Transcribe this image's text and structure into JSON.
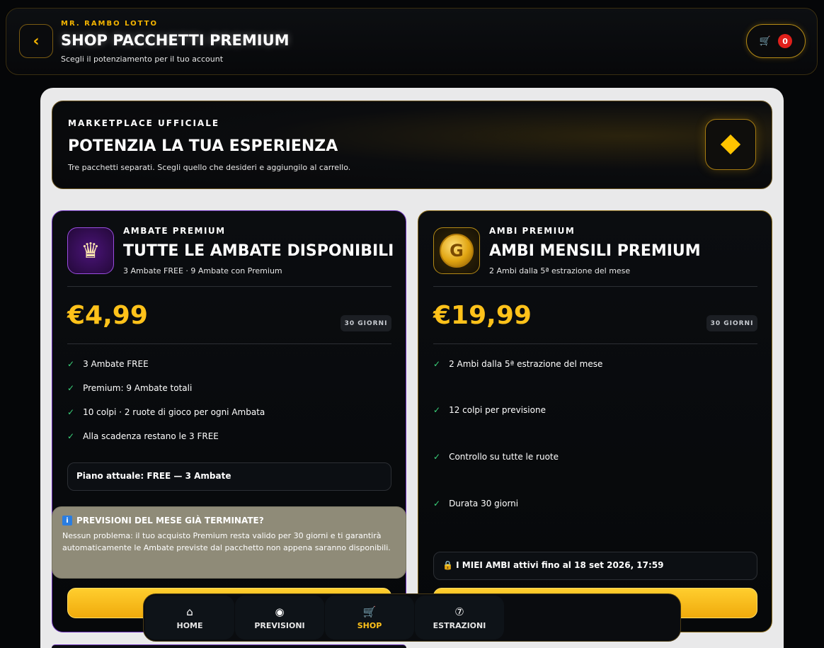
{
  "header": {
    "brand": "MR. RAMBO LOTTO",
    "title": "SHOP PACCHETTI PREMIUM",
    "subtitle": "Scegli il potenziamento per il tuo account",
    "back_icon": "chevron-left-icon",
    "cart_icon": "cart-icon",
    "cart_count": "0"
  },
  "hero": {
    "kicker": "MARKETPLACE UFFICIALE",
    "title": "POTENZIA LA TUA ESPERIENZA",
    "subtitle": "Tre pacchetti separati. Scegli quello che desideri e aggiungilo al carrello.",
    "badge_icon": "diamond-icon"
  },
  "cards": [
    {
      "kicker": "AMBATE PREMIUM",
      "title": "TUTTE LE AMBATE DISPONIBILI",
      "subtitle": "3 Ambate FREE · 9 Ambate con Premium",
      "icon": "crown-icon",
      "price": "€4,99",
      "duration": "30 GIORNI",
      "features": [
        "3 Ambate FREE",
        "Premium: 9 Ambate totali",
        "10 colpi · 2 ruote di gioco per ogni Ambata",
        "Alla scadenza restano le 3 FREE"
      ],
      "plan_status": "Piano attuale: FREE — 3 Ambate"
    },
    {
      "kicker": "AMBI PREMIUM",
      "title": "AMBI MENSILI PREMIUM",
      "subtitle": "2 Ambi dalla 5ª estrazione del mese",
      "icon": "coin-icon",
      "coin_letter": "G",
      "price": "€19,99",
      "duration": "30 GIORNI",
      "features": [
        "2 Ambi dalla 5ª estrazione del mese",
        "12 colpi per previsione",
        "Controllo su tutte le ruote",
        "Durata 30 giorni"
      ],
      "active_status": "I MIEI AMBI attivi fino al 18 set 2026, 17:59"
    }
  ],
  "notice": {
    "title": "PREVISIONI DEL MESE GIÀ TERMINATE?",
    "text": "Nessun problema: il tuo acquisto Premium resta valido per 30 giorni e ti garantirà automaticamente le Ambate previste dal pacchetto non appena saranno disponibili."
  },
  "nav": {
    "items": [
      {
        "label": "HOME",
        "icon": "home-icon",
        "glyph": "⌂"
      },
      {
        "label": "PREVISIONI",
        "icon": "eye-icon",
        "glyph": "◉"
      },
      {
        "label": "SHOP",
        "icon": "cart-icon",
        "glyph": "🛒"
      },
      {
        "label": "ESTRAZIONI",
        "icon": "number-ball-icon",
        "glyph": "⑦"
      }
    ],
    "active": "SHOP"
  },
  "colors": {
    "accent": "#ffc21a",
    "purple_border": "#6a2fb8",
    "gold_border": "#8a6a18",
    "check": "#3ad17a",
    "cart_badge": "#e0201b"
  }
}
